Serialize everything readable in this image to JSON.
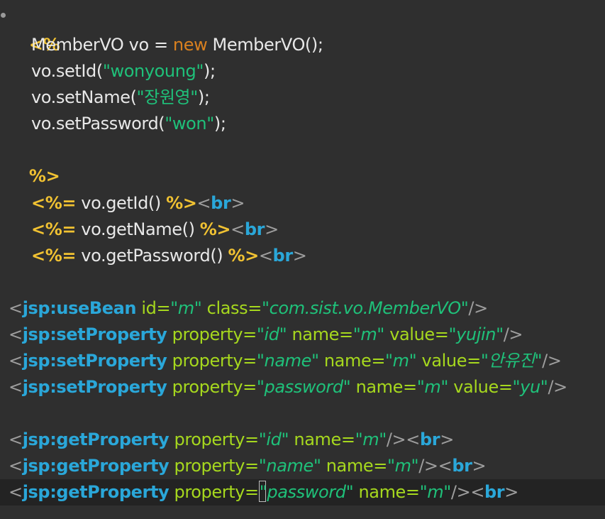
{
  "editor": {
    "open_scriptlet": "<%",
    "close_scriptlet": "%>",
    "java": {
      "l1_a": "MemberVO vo = ",
      "l1_new": "new",
      "l1_b": " MemberVO();",
      "l2_a": "vo.setId(",
      "l2_str": "\"wonyoung\"",
      "l2_b": ");",
      "l3_a": "vo.setName(",
      "l3_str": "\"장원영\"",
      "l3_b": ");",
      "l4_a": "vo.setPassword(",
      "l4_str": "\"won\"",
      "l4_b": ");"
    },
    "expr": {
      "open": "<%=",
      "close": "%>",
      "e1": " vo.getId() ",
      "e2": " vo.getName() ",
      "e3": " vo.getPassword() ",
      "lt": "<",
      "gt": ">",
      "br": "br"
    },
    "jsp": {
      "lt": "<",
      "gt": ">",
      "selfclose": "/>",
      "eq": "=",
      "useBean": "jsp:useBean",
      "setProperty": "jsp:setProperty",
      "getProperty": "jsp:getProperty",
      "attr_id": "id",
      "attr_class": "class",
      "attr_property": "property",
      "attr_name": "name",
      "attr_value": "value",
      "val_m": "\"m\"",
      "val_class": "\"com.sist.vo.MemberVO\"",
      "val_id": "\"id\"",
      "val_name": "\"name\"",
      "val_password": "\"password\"",
      "val_yujin": "\"yujin\"",
      "val_anyujin": "\"안유진\"",
      "val_yu": "\"yu\"",
      "br": "br"
    }
  }
}
